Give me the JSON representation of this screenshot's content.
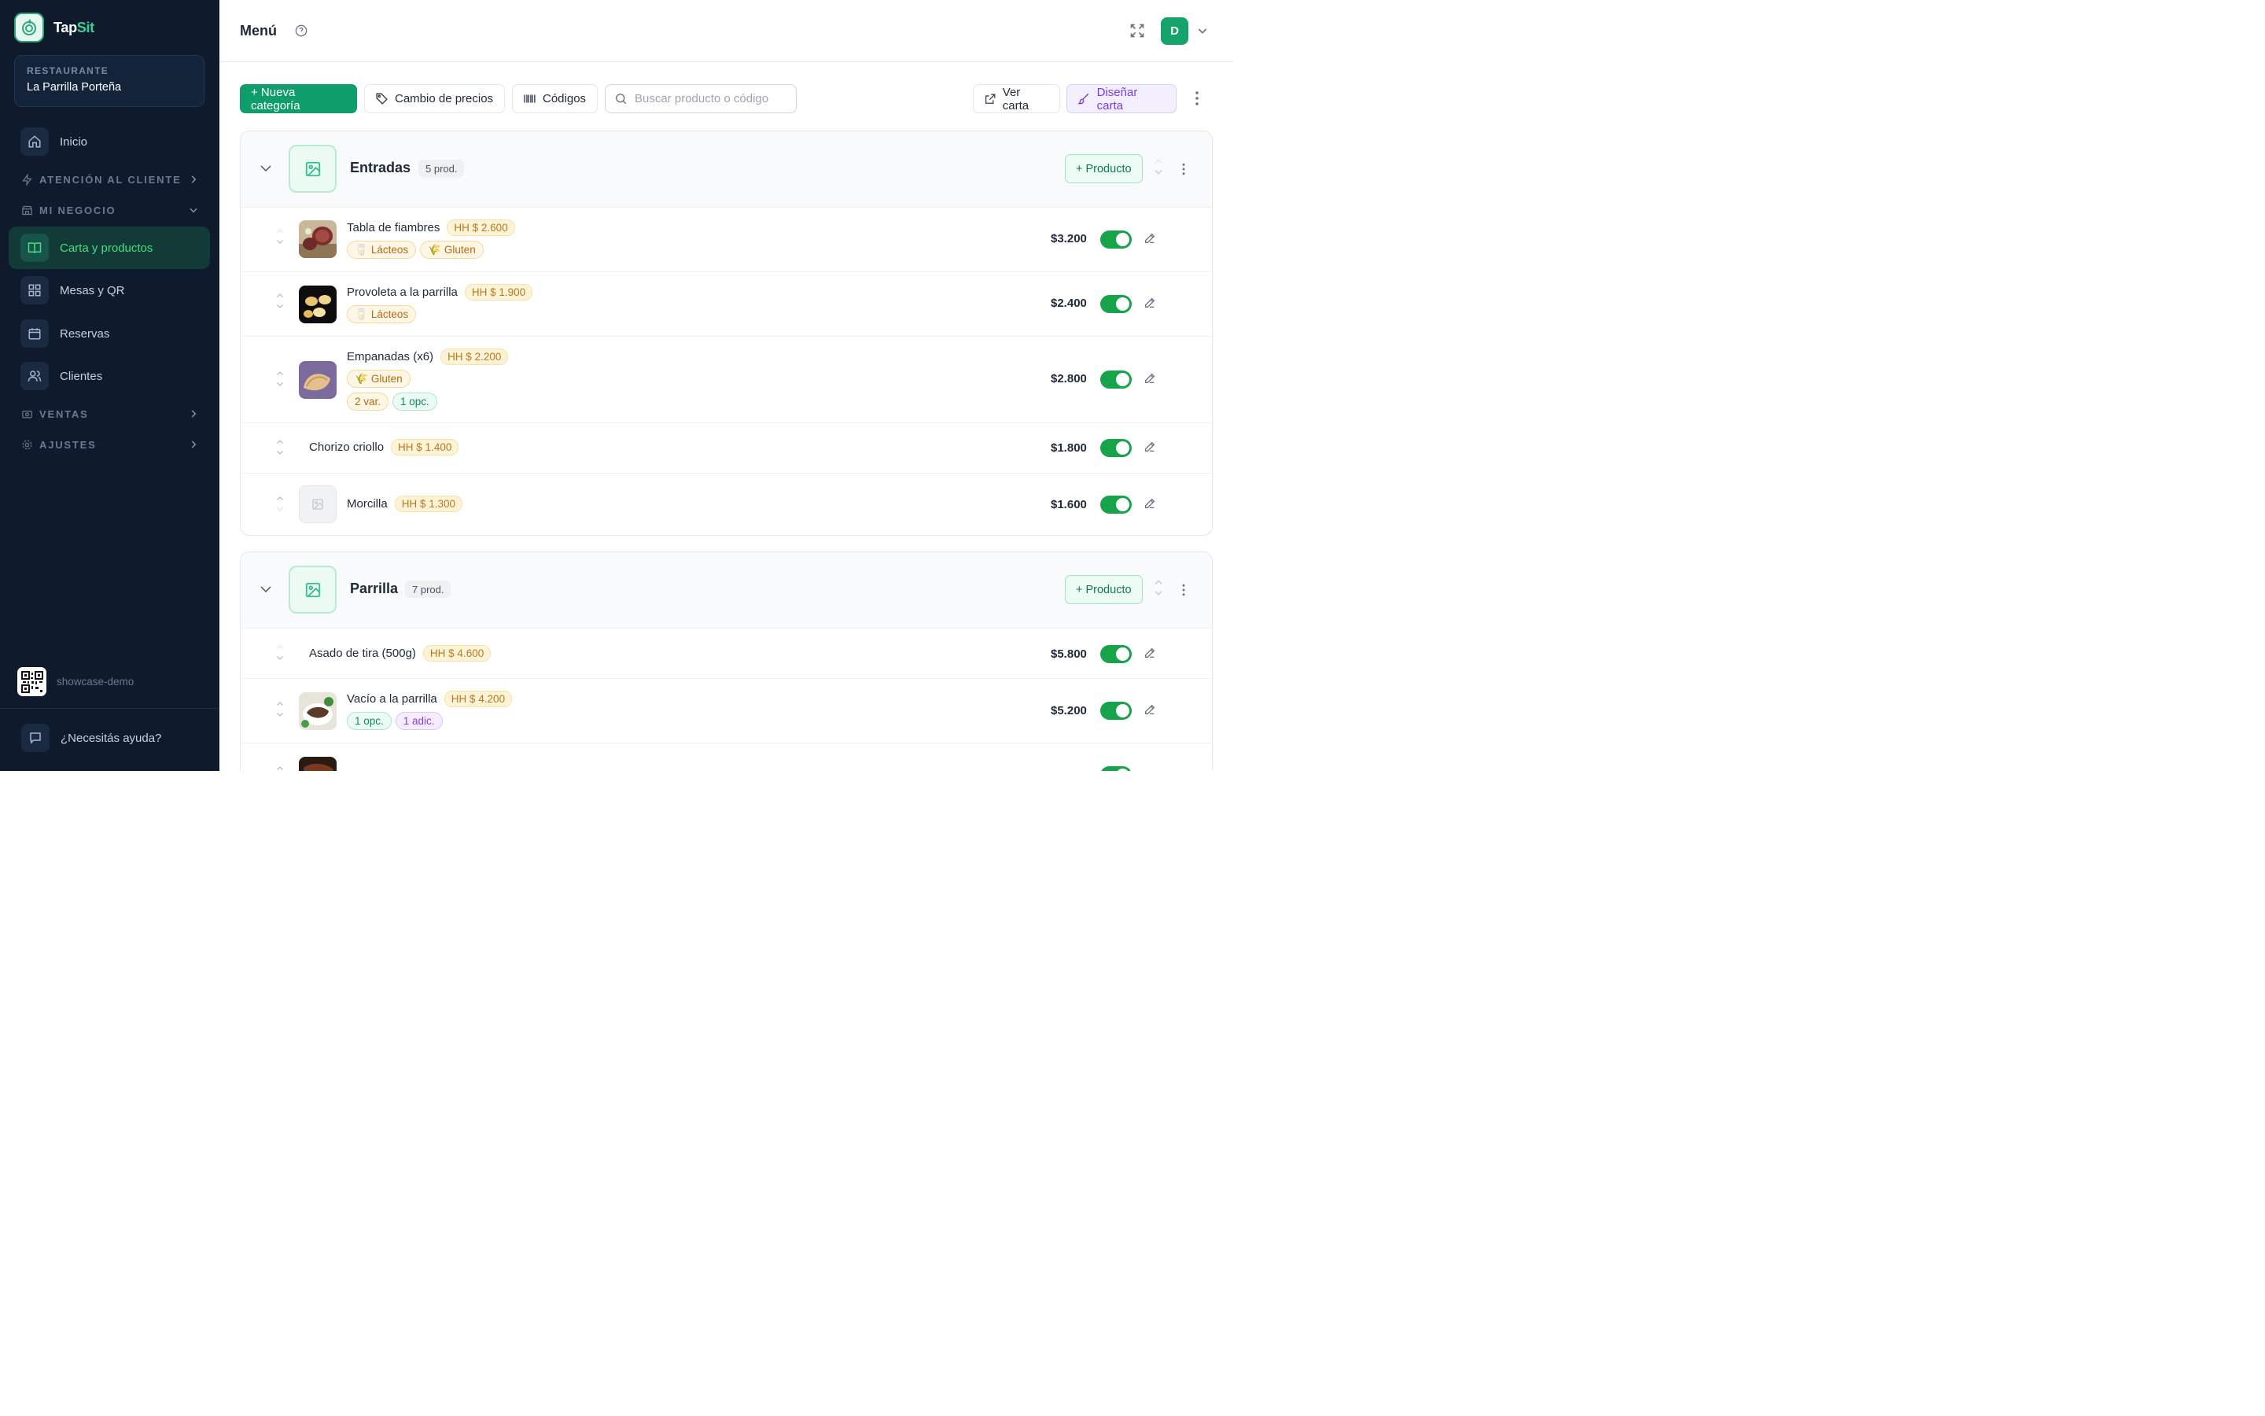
{
  "brand": {
    "name_part1": "Tap",
    "name_part2": "Sit"
  },
  "restaurant": {
    "label": "RESTAURANTE",
    "name": "La Parrilla Porteña"
  },
  "nav": {
    "inicio": "Inicio",
    "atencion": "ATENCIÓN AL CLIENTE",
    "negocio": "MI NEGOCIO",
    "carta": "Carta y productos",
    "mesas": "Mesas y QR",
    "reservas": "Reservas",
    "clientes": "Clientes",
    "ventas": "VENTAS",
    "ajustes": "AJUSTES"
  },
  "footer": {
    "account": "showcase-demo",
    "help": "¿Necesitás ayuda?"
  },
  "header": {
    "title": "Menú",
    "avatar": "D"
  },
  "toolbar": {
    "new_category": "+ Nueva categoría",
    "price_change": "Cambio de precios",
    "codes": "Códigos",
    "search_placeholder": "Buscar producto o código",
    "view_menu": "Ver carta",
    "design_menu": "Diseñar carta"
  },
  "add_product_label": "+ Producto",
  "categories": [
    {
      "name": "Entradas",
      "count": "5 prod.",
      "products": [
        {
          "name": "Tabla de fiambres",
          "hh": "HH $ 2.600",
          "price": "$3.200",
          "tags": [
            "Lácteos",
            "Gluten"
          ]
        },
        {
          "name": "Provoleta a la parrilla",
          "hh": "HH $ 1.900",
          "price": "$2.400",
          "tags": [
            "Lácteos"
          ]
        },
        {
          "name": "Empanadas (x6)",
          "hh": "HH $ 2.200",
          "price": "$2.800",
          "tags": [
            "Gluten"
          ],
          "extras": [
            "2 var.",
            "1 opc."
          ]
        },
        {
          "name": "Chorizo criollo",
          "hh": "HH $ 1.400",
          "price": "$1.800"
        },
        {
          "name": "Morcilla",
          "hh": "HH $ 1.300",
          "price": "$1.600"
        }
      ]
    },
    {
      "name": "Parrilla",
      "count": "7 prod.",
      "products": [
        {
          "name": "Asado de tira (500g)",
          "hh": "HH $ 4.600",
          "price": "$5.800"
        },
        {
          "name": "Vacío a la parrilla",
          "hh": "HH $ 4.200",
          "price": "$5.200",
          "extras": [
            "1 opc.",
            "1 adic."
          ]
        }
      ]
    }
  ],
  "colors": {
    "sidebar": "#0f1b2c",
    "accent": "#0f9d69",
    "toggle_on": "#16a34a",
    "hh_badge": "#fdf3d7"
  }
}
